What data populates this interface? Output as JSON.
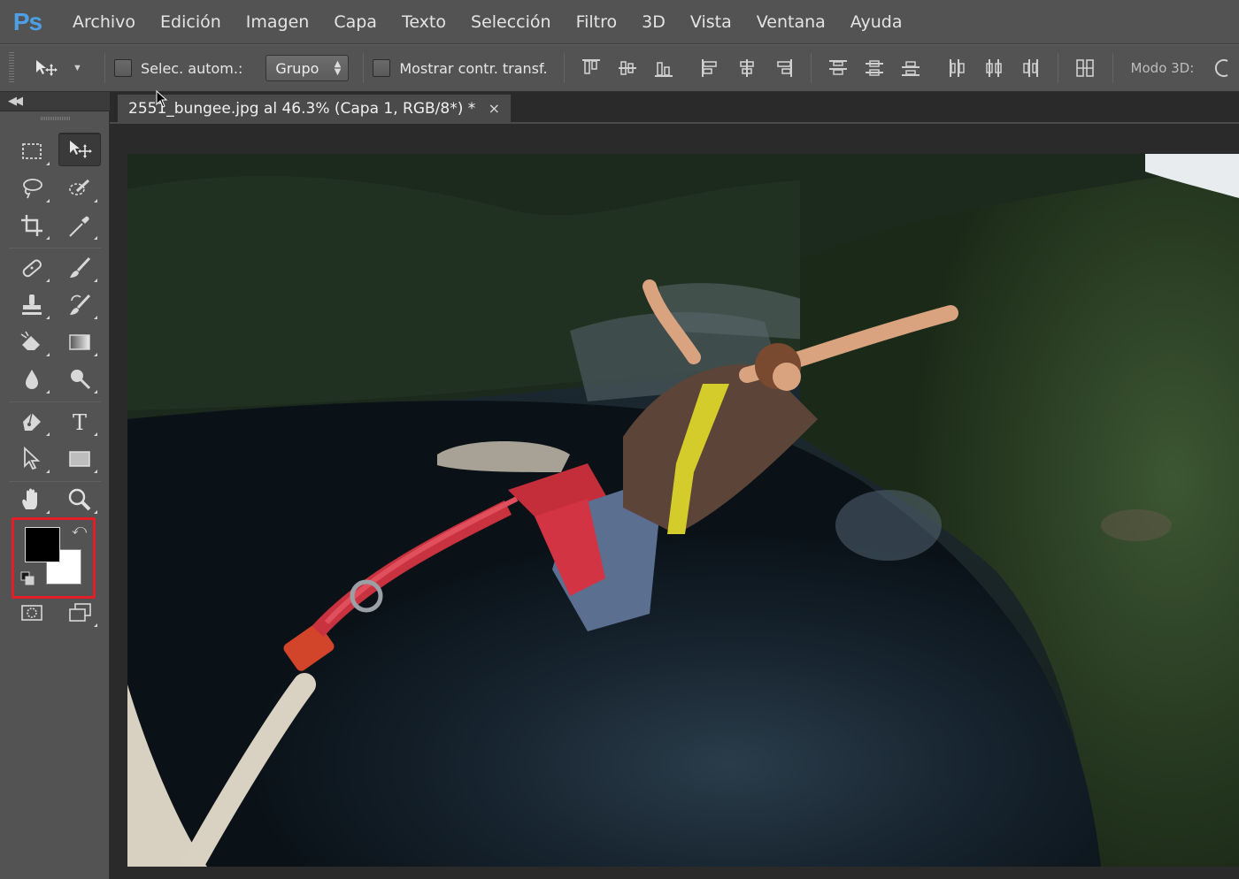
{
  "app": {
    "logo": "Ps"
  },
  "menu": {
    "items": [
      "Archivo",
      "Edición",
      "Imagen",
      "Capa",
      "Texto",
      "Selección",
      "Filtro",
      "3D",
      "Vista",
      "Ventana",
      "Ayuda"
    ]
  },
  "options": {
    "auto_select_label": "Selec. autom.:",
    "auto_select_value": "Grupo",
    "show_transform_label": "Mostrar contr. transf.",
    "mode3d_label": "Modo 3D:"
  },
  "document": {
    "tab_title": "2551_bungee.jpg al 46.3% (Capa 1, RGB/8*) *",
    "close_glyph": "×"
  },
  "colors": {
    "foreground": "#000000",
    "background": "#ffffff",
    "highlight": "#e41e26",
    "ps_blue": "#4ea0e6"
  },
  "icons": {
    "align": [
      "align-top-edges-icon",
      "align-vertical-centers-icon",
      "align-bottom-edges-icon",
      "align-left-edges-icon",
      "align-horizontal-centers-icon",
      "align-right-edges-icon",
      "distribute-top-icon",
      "distribute-vertical-centers-icon",
      "distribute-bottom-icon",
      "distribute-left-icon",
      "distribute-horizontal-centers-icon",
      "distribute-right-icon",
      "auto-align-layers-icon"
    ],
    "tools": [
      "rectangular-marquee-icon",
      "move-tool-icon",
      "lasso-icon",
      "quick-selection-icon",
      "crop-icon",
      "eyedropper-icon",
      "spot-healing-brush-icon",
      "brush-icon",
      "clone-stamp-icon",
      "history-brush-icon",
      "eraser-icon",
      "gradient-icon",
      "blur-icon",
      "dodge-icon",
      "pen-icon",
      "type-icon",
      "path-selection-icon",
      "rectangle-shape-icon",
      "hand-icon",
      "zoom-icon",
      "quick-mask-icon",
      "screen-mode-icon"
    ]
  }
}
